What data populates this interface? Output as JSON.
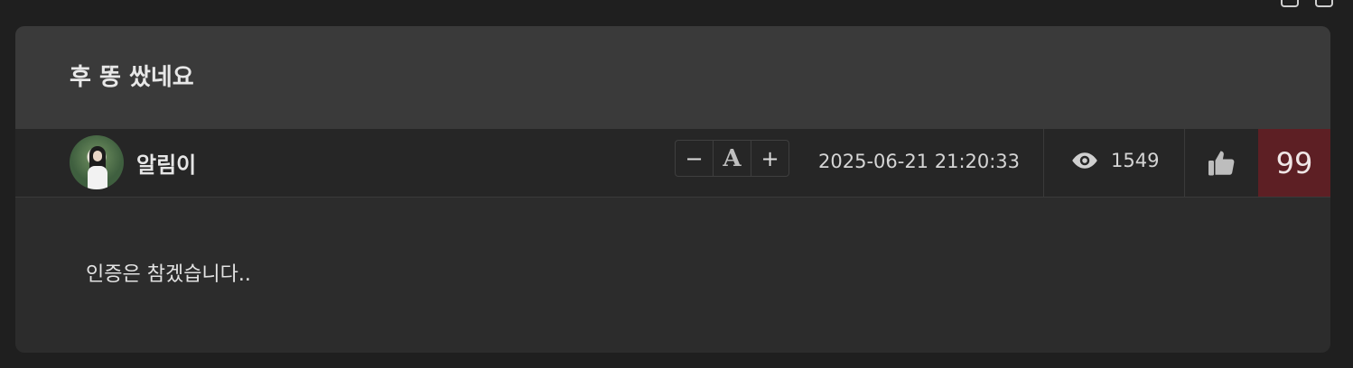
{
  "post": {
    "title": "후 똥 쌌네요",
    "author": "알림이",
    "date": "2025-06-21 21:20:33",
    "views": "1549",
    "likes": "99",
    "body": "인증은 참겠습니다.."
  },
  "font_control": {
    "decrease": "−",
    "font": "A",
    "increase": "+"
  },
  "icons": {
    "views": "eye-icon",
    "like": "thumbs-up-icon",
    "checkbox": "checkbox-icon"
  },
  "colors": {
    "background": "#1f1f1f",
    "card": "#2c2c2c",
    "header": "#3a3a3a",
    "like_count_bg": "#5d1f24"
  }
}
